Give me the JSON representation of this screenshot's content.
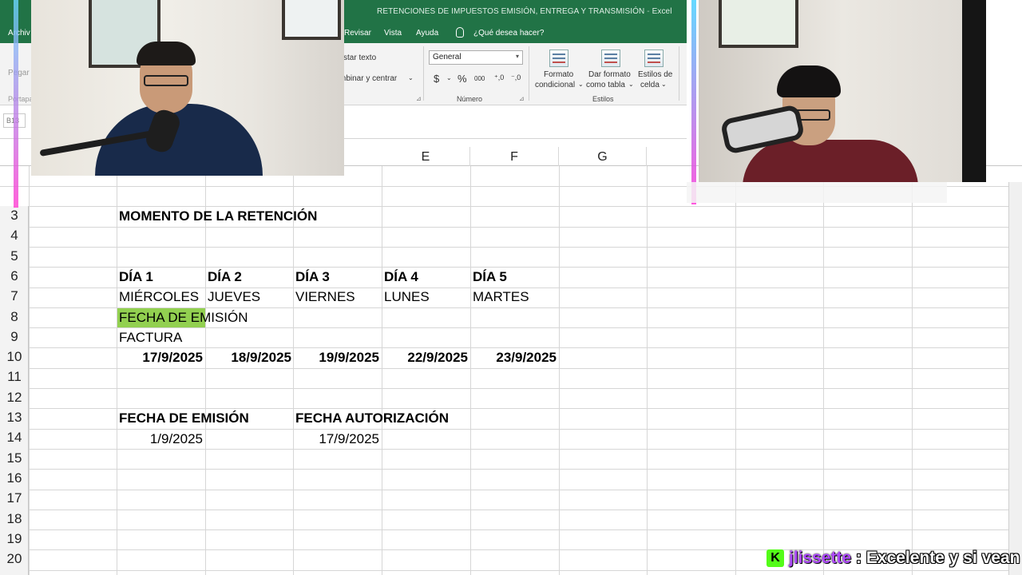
{
  "window": {
    "title": "RETENCIONES DE IMPUESTOS EMISIÓN, ENTREGA Y TRANSMISIÓN",
    "app": "Excel"
  },
  "menu": {
    "file_partial": "Archiv",
    "revisar": "Revisar",
    "vista": "Vista",
    "ayuda": "Ayuda",
    "search": "¿Qué desea hacer?"
  },
  "ribbon": {
    "wrap_text": "star texto",
    "merge_center": "mbinar y centrar",
    "number_format": "General",
    "currency_symbol": "$",
    "percent_symbol": "%",
    "thousands": "000",
    "decimal_up": "⁺,0",
    "decimal_down": "⁻,0",
    "group_number": "Número",
    "cond_format_line1": "Formato",
    "cond_format_line2": "condicional",
    "table_format_line1": "Dar formato",
    "table_format_line2": "como tabla",
    "cell_styles_line1": "Estilos de",
    "cell_styles_line2": "celda",
    "group_styles": "Estilos",
    "paste_partial": "Pegar",
    "clipboard_partial": "Portapa",
    "namebox_partial": "B13"
  },
  "columns": [
    "E",
    "F",
    "G"
  ],
  "rows": [
    "3",
    "4",
    "5",
    "6",
    "7",
    "8",
    "9",
    "10",
    "11",
    "12",
    "13",
    "14",
    "15",
    "16",
    "17",
    "18",
    "19",
    "20"
  ],
  "cells": {
    "r3": "MOMENTO DE LA RETENCIÓN",
    "r6": [
      "DÍA 1",
      "DÍA 2",
      "DÍA 3",
      "DÍA 4",
      "DÍA 5"
    ],
    "r7": [
      "MIÉRCOLES",
      "JUEVES",
      "VIERNES",
      "LUNES",
      "MARTES"
    ],
    "r8": "FECHA DE EMISIÓN",
    "r9": "FACTURA",
    "r10": [
      "17/9/2025",
      "18/9/2025",
      "19/9/2025",
      "22/9/2025",
      "23/9/2025"
    ],
    "r13": [
      "FECHA DE EMISIÓN",
      "FECHA AUTORIZACIÓN"
    ],
    "r14": [
      "1/9/2025",
      "17/9/2025"
    ]
  },
  "colors": {
    "excel_green": "#217346",
    "highlight_cell": "#92d050",
    "chat_user": "#b04bff",
    "kick_badge": "#53fc18"
  },
  "chat": {
    "badge": "K",
    "username": "jlissette",
    "separator": " : ",
    "message": "Excelente y si vean"
  }
}
